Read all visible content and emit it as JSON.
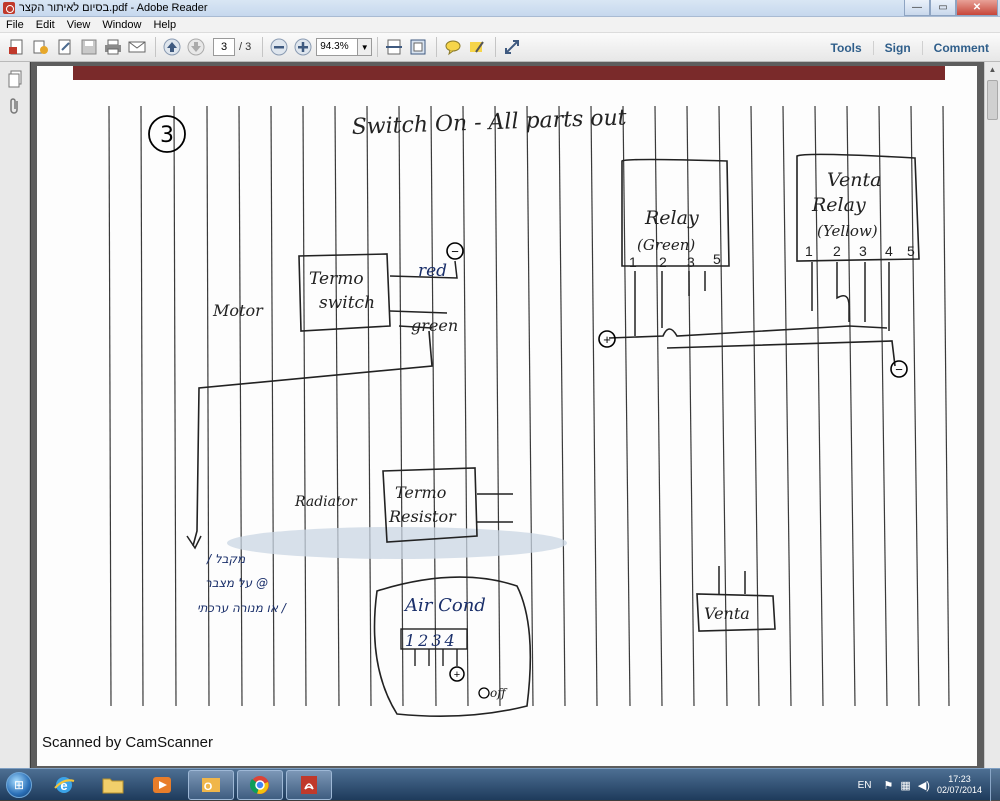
{
  "window": {
    "title": "בסיום לאיתור הקצר.pdf - Adobe Reader",
    "minimize": "—",
    "maximize": "▭",
    "close": "✕"
  },
  "menu": [
    "File",
    "Edit",
    "View",
    "Window",
    "Help"
  ],
  "toolbar": {
    "current_page": "3",
    "total_pages": "/ 3",
    "zoom": "94.3%",
    "links": [
      "Tools",
      "Sign",
      "Comment"
    ]
  },
  "document": {
    "page_number": "3",
    "heading": "Switch On - All parts out",
    "relay_green": {
      "name": "Relay",
      "color": "(Green)",
      "pins": [
        "1",
        "2",
        "3",
        "5"
      ]
    },
    "relay_yellow": {
      "name1": "Venta",
      "name2": "Relay",
      "color": "(Yellow)",
      "pins": [
        "1",
        "2",
        "3",
        "4",
        "5"
      ]
    },
    "termo_switch": {
      "line1": "Termo",
      "line2": "switch"
    },
    "motor_label": "Motor",
    "wire_red": "red",
    "wire_green": "green",
    "radiator_label": "Radiator",
    "termo_resistor": {
      "line1": "Termo",
      "line2": "Resistor"
    },
    "air_cond": {
      "label": "Air Cond",
      "pins": "1234",
      "off_label": "off"
    },
    "venta_label": "Venta",
    "hebrew_notes": [
      "מקבל /",
      "@ על מצבר",
      "/ או מנורה ערכתי"
    ],
    "plus_sign": "+",
    "minus_sign": "−",
    "scanned_by": "Scanned by CamScanner"
  },
  "taskbar": {
    "apps": [
      "explorer-ie",
      "file-explorer",
      "media-player",
      "outlook",
      "chrome",
      "adobe-reader"
    ],
    "language": "EN",
    "time": "17:23",
    "date": "02/07/2014"
  }
}
